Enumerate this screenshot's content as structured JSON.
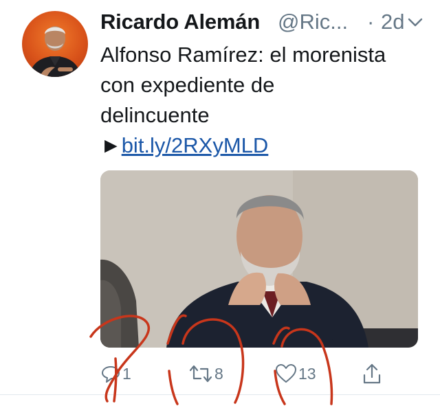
{
  "tweet": {
    "display_name": "Ricardo Alemán",
    "handle": "@Ric...",
    "separator": "·",
    "time": "2d",
    "text_lines": [
      "Alfonso Ramírez: el morenista",
      "con expediente de",
      "delincuente"
    ],
    "link_prefix": "►",
    "link_text": "bit.ly/2RXyMLD"
  },
  "actions": {
    "reply_count": "1",
    "retweet_count": "8",
    "like_count": "13"
  },
  "icons": {
    "caret": "chevron-down-icon",
    "reply": "reply-icon",
    "retweet": "retweet-icon",
    "like": "heart-icon",
    "share": "share-icon"
  },
  "colors": {
    "name_text": "#14171a",
    "meta_text": "#657786",
    "link": "#1b57a8",
    "annotation_marks": "#c8361b"
  }
}
